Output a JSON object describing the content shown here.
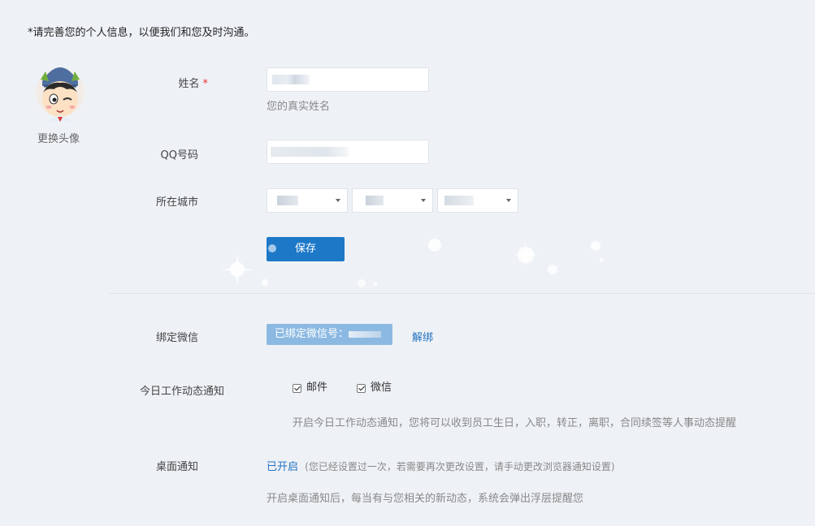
{
  "notice": "*请完善您的个人信息，以便我们和您及时沟通。",
  "avatar": {
    "change_label": "更换头像"
  },
  "form": {
    "name_label": "姓名",
    "name_required": "*",
    "name_hint": "您的真实姓名",
    "qq_label": "QQ号码",
    "city_label": "所在城市",
    "save_label": "保存"
  },
  "wechat": {
    "label": "绑定微信",
    "bound_text": "已绑定微信号：",
    "unbind_label": "解绑"
  },
  "daily_notify": {
    "label": "今日工作动态通知",
    "options": [
      "邮件",
      "微信"
    ],
    "checked": [
      true,
      true
    ],
    "hint": "开启今日工作动态通知，您将可以收到员工生日，入职，转正，离职，合同续签等人事动态提醒"
  },
  "desktop_notify": {
    "label": "桌面通知",
    "status": "已开启",
    "status_note": "(您已经设置过一次，若需要再次更改设置，请手动更改浏览器通知设置)",
    "hint": "开启桌面通知后，每当有与您相关的新动态，系统会弹出浮层提醒您"
  },
  "colors": {
    "primary": "#1d78c8",
    "link": "#2471c0",
    "bound_badge": "#8cb9e2",
    "required": "#e33333"
  }
}
